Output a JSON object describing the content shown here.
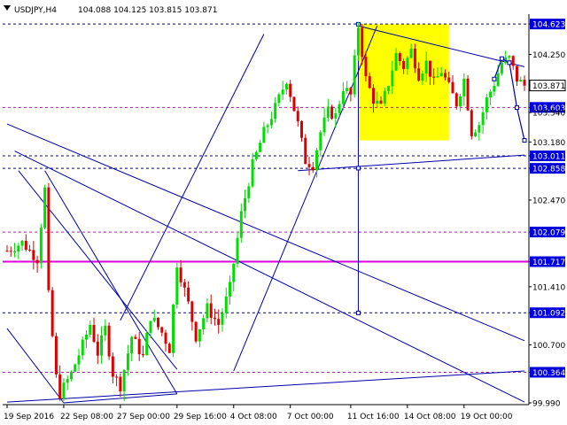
{
  "header": {
    "symbol": "USDJPY,H4",
    "ohlc": "104.088 104.125 103.815 103.871"
  },
  "colors": {
    "bull": "#00dd00",
    "bear": "#dd0000",
    "trend": "#0000aa",
    "magenta": "#dd00dd",
    "highlight": "#ffff00",
    "axis": "#000000",
    "price_box": "#0000dd"
  },
  "chart_data": {
    "type": "candlestick",
    "timeframe": "H4",
    "ylim": [
      99.99,
      104.7
    ],
    "y_ticks": [
      {
        "value": 104.623,
        "label": "104.623",
        "highlight": true
      },
      {
        "value": 104.25,
        "label": "104.250",
        "highlight": false
      },
      {
        "value": 103.871,
        "label": "103.871",
        "highlight": "current"
      },
      {
        "value": 103.603,
        "label": "103.603",
        "highlight": true
      },
      {
        "value": 103.54,
        "label": "103.540",
        "highlight": false
      },
      {
        "value": 103.18,
        "label": "103.180",
        "highlight": false
      },
      {
        "value": 103.011,
        "label": "103.011",
        "highlight": true
      },
      {
        "value": 102.858,
        "label": "102.858",
        "highlight": true
      },
      {
        "value": 102.47,
        "label": "102.470",
        "highlight": false
      },
      {
        "value": 102.079,
        "label": "102.079",
        "highlight": true
      },
      {
        "value": 101.717,
        "label": "101.717",
        "highlight": true
      },
      {
        "value": 101.41,
        "label": "101.410",
        "highlight": false
      },
      {
        "value": 101.092,
        "label": "101.092",
        "highlight": true
      },
      {
        "value": 100.7,
        "label": "100.700",
        "highlight": false
      },
      {
        "value": 100.364,
        "label": "100.364",
        "highlight": true
      },
      {
        "value": 99.99,
        "label": "99.990",
        "highlight": false
      }
    ],
    "x_labels": [
      "19 Sep 2016",
      "22 Sep 08:00",
      "27 Sep 00:00",
      "29 Sep 16:00",
      "4 Oct 08:00",
      "7 Oct 00:00",
      "11 Oct 16:00",
      "14 Oct 08:00",
      "19 Oct 00:00"
    ],
    "x_label_index": [
      0,
      15,
      30,
      45,
      60,
      75,
      91,
      106,
      121
    ],
    "candle_count": 138,
    "levels": [
      {
        "value": 104.623,
        "style": "dash-blue"
      },
      {
        "value": 103.603,
        "style": "dash-magenta"
      },
      {
        "value": 103.011,
        "style": "dash-blue"
      },
      {
        "value": 102.858,
        "style": "dash-blue"
      },
      {
        "value": 102.079,
        "style": "dash-magenta"
      },
      {
        "value": 101.717,
        "style": "solid-magenta"
      },
      {
        "value": 101.092,
        "style": "dash-blue"
      },
      {
        "value": 100.364,
        "style": "dash-magenta"
      }
    ],
    "waypoints": [
      [
        0,
        101.85
      ],
      [
        4,
        101.95
      ],
      [
        8,
        101.75
      ],
      [
        10,
        102.6
      ],
      [
        11,
        101.3
      ],
      [
        13,
        100.3
      ],
      [
        14,
        100.1
      ],
      [
        17,
        100.35
      ],
      [
        20,
        100.7
      ],
      [
        22,
        100.95
      ],
      [
        24,
        100.6
      ],
      [
        26,
        100.9
      ],
      [
        28,
        100.35
      ],
      [
        30,
        100.2
      ],
      [
        33,
        100.8
      ],
      [
        36,
        100.55
      ],
      [
        38,
        101.05
      ],
      [
        41,
        100.85
      ],
      [
        43,
        100.65
      ],
      [
        45,
        101.7
      ],
      [
        48,
        101.2
      ],
      [
        50,
        100.8
      ],
      [
        53,
        101.15
      ],
      [
        56,
        100.95
      ],
      [
        59,
        101.4
      ],
      [
        62,
        102.3
      ],
      [
        65,
        102.9
      ],
      [
        68,
        103.3
      ],
      [
        71,
        103.6
      ],
      [
        74,
        103.95
      ],
      [
        77,
        103.4
      ],
      [
        79,
        102.95
      ],
      [
        81,
        102.9
      ],
      [
        83,
        103.3
      ],
      [
        85,
        103.55
      ],
      [
        87,
        103.5
      ],
      [
        89,
        103.85
      ],
      [
        91,
        103.75
      ],
      [
        93,
        104.6
      ],
      [
        95,
        103.95
      ],
      [
        97,
        103.7
      ],
      [
        99,
        103.6
      ],
      [
        101,
        103.9
      ],
      [
        103,
        104.25
      ],
      [
        105,
        104.1
      ],
      [
        107,
        104.3
      ],
      [
        109,
        104.0
      ],
      [
        111,
        104.15
      ],
      [
        113,
        103.9
      ],
      [
        115,
        104.05
      ],
      [
        117,
        103.85
      ],
      [
        119,
        103.65
      ],
      [
        121,
        103.95
      ],
      [
        123,
        103.3
      ],
      [
        125,
        103.4
      ],
      [
        127,
        103.7
      ],
      [
        129,
        103.9
      ],
      [
        131,
        104.15
      ],
      [
        133,
        104.2
      ],
      [
        135,
        103.95
      ],
      [
        137,
        103.87
      ]
    ],
    "highlight_box": {
      "x_from": 93,
      "x_to": 117,
      "y_from": 103.2,
      "y_to": 104.62
    },
    "trend_lines": [
      {
        "from": [
          0,
          103.4
        ],
        "to": [
          137,
          100.75
        ]
      },
      {
        "from": [
          2,
          103.07
        ],
        "to": [
          137,
          100.0
        ]
      },
      {
        "from": [
          0,
          100.0
        ],
        "to": [
          137,
          100.38
        ]
      },
      {
        "from": [
          60,
          100.38
        ],
        "to": [
          98,
          104.6
        ]
      },
      {
        "from": [
          30,
          101.0
        ],
        "to": [
          68,
          104.5
        ]
      },
      {
        "from": [
          77,
          102.83
        ],
        "to": [
          137,
          103.02
        ]
      },
      {
        "from": [
          93,
          104.6
        ],
        "to": [
          137,
          104.1
        ]
      },
      {
        "from": [
          3,
          102.83
        ],
        "to": [
          45,
          100.4
        ]
      },
      {
        "from": [
          0,
          100.9
        ],
        "to": [
          15,
          99.99
        ]
      },
      {
        "from": [
          15,
          99.99
        ],
        "to": [
          45,
          100.1
        ]
      },
      {
        "from": [
          10,
          102.83
        ],
        "to": [
          45,
          100.1
        ]
      }
    ],
    "forecast": [
      [
        129,
        103.95
      ],
      [
        131,
        104.2
      ],
      [
        133,
        104.15
      ],
      [
        135,
        103.6
      ],
      [
        137,
        103.2
      ]
    ],
    "vertical_marker": {
      "x": 93,
      "from": 104.62,
      "to": 101.09
    }
  }
}
